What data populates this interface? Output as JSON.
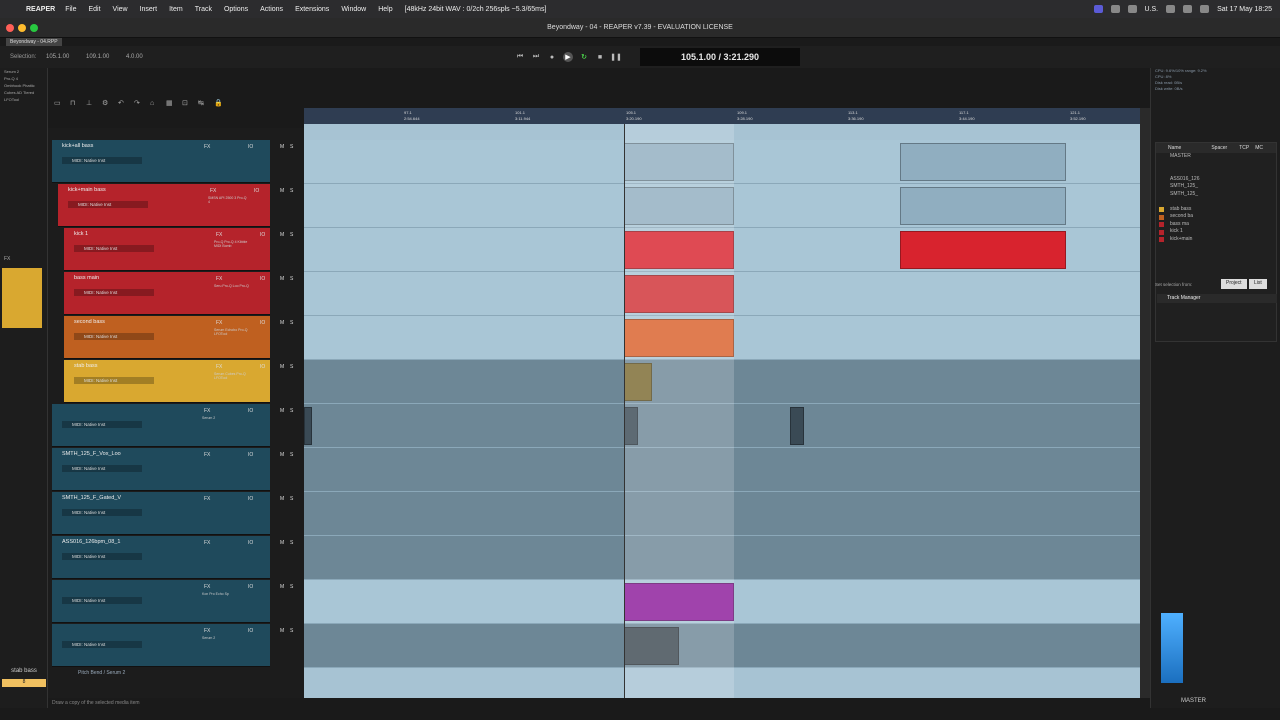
{
  "macbar": {
    "app": "REAPER",
    "menus": [
      "File",
      "Edit",
      "View",
      "Insert",
      "Item",
      "Track",
      "Options",
      "Actions",
      "Extensions",
      "Window",
      "Help"
    ],
    "info": "[48kHz 24bit WAV : 0/2ch 256spls ~5.3/65ms]",
    "datetime": "Sat 17 May  18:25",
    "locale": "U.S."
  },
  "window": {
    "title": "Beyondway - 04 - REAPER v7.39 - EVALUATION LICENSE",
    "project_tab": "Beyondway - 04.RPP"
  },
  "transport": {
    "selection_label": "Selection:",
    "sel_start": "105.1.00",
    "sel_end": "109.1.00",
    "sel_len": "4.0.00",
    "time": "105.1.00 / 3:21.290"
  },
  "left_strip": {
    "fx_list": [
      "Serum 2",
      "Pro-Q 4",
      "Ombhook Phattic",
      "Cubes AD Tiered",
      "LFOTool"
    ],
    "fx_label": "FX",
    "track_label": "stab bass",
    "master_label": "8"
  },
  "tracks": [
    {
      "name": "kick+all bass",
      "midi": "MIDI: Native Inst",
      "plugins": "",
      "color": "#1f4a5c",
      "indent": 0
    },
    {
      "name": "kick+main bass",
      "midi": "MIDI: Native Inst",
      "plugins": "SMSN API 2500 3 Pro-Q 4",
      "color": "#b5232b",
      "indent": 6
    },
    {
      "name": "kick 1",
      "midi": "MIDI: Native Inst",
      "plugins": "Pro-Q Pro-Q 4 Kibble MIDI Bomb",
      "color": "#b5232b",
      "indent": 12
    },
    {
      "name": "bass main",
      "midi": "MIDI: Native Inst",
      "plugins": "Seru Pro-Q Loo Pro-Q",
      "color": "#b5232b",
      "indent": 12
    },
    {
      "name": "second bass",
      "midi": "MIDI: Native Inst",
      "plugins": "Serum Echobo Pro-Q LFOTool",
      "color": "#bf6020",
      "indent": 12
    },
    {
      "name": "stab bass",
      "midi": "MIDI: Native Inst",
      "plugins": "Serum Cubes Pro-Q LFOTool",
      "color": "#d9a830",
      "indent": 12
    },
    {
      "name": "",
      "midi": "MIDI: Native Inst",
      "plugins": "Serum 2",
      "color": "#1f4a5c",
      "indent": 0
    },
    {
      "name": "SMTH_125_F_Vox_Loo",
      "midi": "MIDI: Native Inst",
      "plugins": "",
      "color": "#1f4a5c",
      "indent": 0
    },
    {
      "name": "SMTH_125_F_Gated_V",
      "midi": "MIDI: Native Inst",
      "plugins": "",
      "color": "#1f4a5c",
      "indent": 0
    },
    {
      "name": "ASS016_126bpm_08_1",
      "midi": "MIDI: Native Inst",
      "plugins": "",
      "color": "#1f4a5c",
      "indent": 0
    },
    {
      "name": "",
      "midi": "MIDI: Native Inst",
      "plugins": "Kon Pro Echo Sp",
      "color": "#1f4a5c",
      "indent": 0
    },
    {
      "name": "",
      "midi": "MIDI: Native Inst",
      "plugins": "Serum 2",
      "color": "#1f4a5c",
      "indent": 0
    }
  ],
  "envelope_lane": {
    "label": "Pitch Bend / Serum 2"
  },
  "ruler": {
    "labels": [
      "97.1",
      "101.1",
      "105.1",
      "109.1",
      "113.1",
      "117.1",
      "121.1"
    ],
    "times": [
      "2:54.644",
      "3:11.944",
      "3:20.190",
      "3:28.190",
      "3:36.190",
      "3:44.190",
      "3:52.190"
    ]
  },
  "right_panel": {
    "stats": [
      "CPU: 9.6%/10%  range: 9.2%",
      "CPU: 8%",
      "Disk read: 0B/s",
      "Disk write: 0B/s"
    ],
    "headers": [
      "Name",
      "Spacer",
      "TCP",
      "MC"
    ],
    "rows": [
      {
        "name": "MASTER",
        "color": ""
      },
      {
        "name": "",
        "color": ""
      },
      {
        "name": "",
        "color": ""
      },
      {
        "name": "ASS016_126",
        "color": ""
      },
      {
        "name": "SMTH_125_",
        "color": ""
      },
      {
        "name": "SMTH_125_",
        "color": ""
      },
      {
        "name": "",
        "color": ""
      },
      {
        "name": "stab bass",
        "color": "#d9a830"
      },
      {
        "name": "second ba",
        "color": "#bf6020"
      },
      {
        "name": "bass ma",
        "color": "#b5232b"
      },
      {
        "name": "kick 1",
        "color": "#b5232b"
      },
      {
        "name": "kick+main",
        "color": "#b5232b"
      }
    ],
    "set_selection": "Set selection from:",
    "btn_project": "Project",
    "btn_list": "List",
    "track_manager": "Track Manager",
    "master": "MASTER"
  },
  "status_bar": "Draw a copy of the selected media item"
}
